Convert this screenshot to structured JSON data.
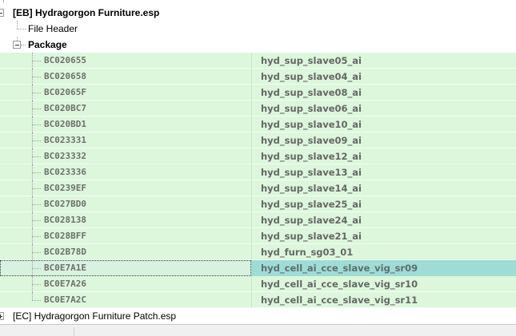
{
  "tree": {
    "plugin_eb": {
      "label": "[EB] Hydragorgon Furniture.esp"
    },
    "file_header": {
      "label": "File Header"
    },
    "package": {
      "label": "Package"
    },
    "records": [
      {
        "form_id": "BC020655",
        "editor_id": "hyd_sup_slave05_ai"
      },
      {
        "form_id": "BC020658",
        "editor_id": "hyd_sup_slave04_ai"
      },
      {
        "form_id": "BC02065F",
        "editor_id": "hyd_sup_slave08_ai"
      },
      {
        "form_id": "BC020BC7",
        "editor_id": "hyd_sup_slave06_ai"
      },
      {
        "form_id": "BC020BD1",
        "editor_id": "hyd_sup_slave10_ai"
      },
      {
        "form_id": "BC023331",
        "editor_id": "hyd_sup_slave09_ai"
      },
      {
        "form_id": "BC023332",
        "editor_id": "hyd_sup_slave12_ai"
      },
      {
        "form_id": "BC023336",
        "editor_id": "hyd_sup_slave13_ai"
      },
      {
        "form_id": "BC0239EF",
        "editor_id": "hyd_sup_slave14_ai"
      },
      {
        "form_id": "BC027BD0",
        "editor_id": "hyd_sup_slave25_ai"
      },
      {
        "form_id": "BC028138",
        "editor_id": "hyd_sup_slave24_ai"
      },
      {
        "form_id": "BC028BFF",
        "editor_id": "hyd_sup_slave21_ai"
      },
      {
        "form_id": "BC02B78D",
        "editor_id": "hyd_furn_sg03_01"
      },
      {
        "form_id": "BC0E7A1E",
        "editor_id": "hyd_cell_ai_cce_slave_vig_sr09",
        "selected": true
      },
      {
        "form_id": "BC0E7A26",
        "editor_id": "hyd_cell_ai_cce_slave_vig_sr10"
      },
      {
        "form_id": "BC0E7A2C",
        "editor_id": "hyd_cell_ai_cce_slave_vig_sr11"
      }
    ],
    "plugin_ec": {
      "label": "[EC] Hydragorgon Furniture Patch.esp"
    }
  },
  "colors": {
    "row_green": "#dcf7dc",
    "row_selected": "#9fdcd5",
    "text_gray": "#6f6f6f"
  },
  "icons": {
    "expand": "plus-box",
    "collapse": "minus-box"
  }
}
